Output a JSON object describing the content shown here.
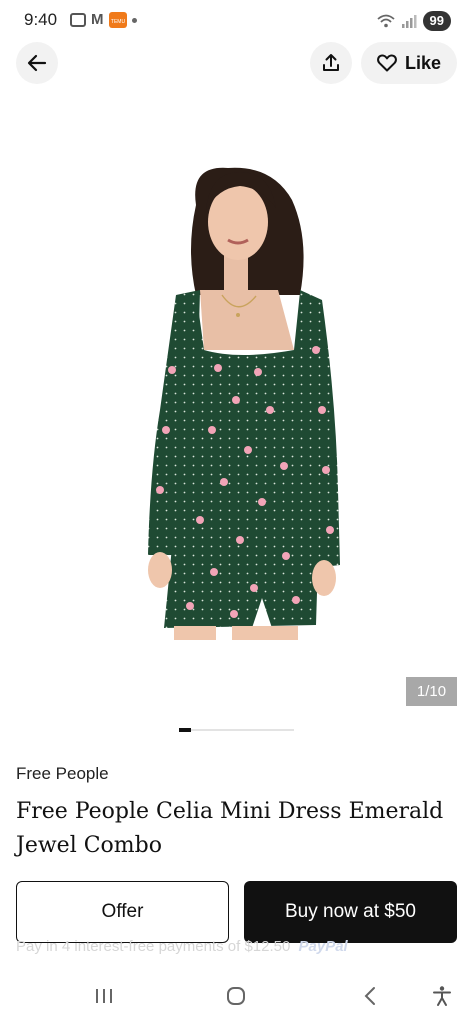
{
  "status_bar": {
    "time": "9:40",
    "app_icon_text": "TEMU",
    "battery": "99",
    "icons": [
      "screenshot-icon",
      "gmail-icon",
      "app-notification-icon",
      "dot-icon",
      "wifi-icon",
      "signal-icon",
      "battery-icon"
    ]
  },
  "top_bar": {
    "like_label": "Like"
  },
  "gallery": {
    "counter": "1/10",
    "current": 1,
    "total": 10
  },
  "product": {
    "brand": "Free People",
    "title": "Free People Celia Mini Dress Emerald Jewel Combo"
  },
  "actions": {
    "offer_label": "Offer",
    "buy_label": "Buy now at $50"
  },
  "payment": {
    "installment_text": "Pay in 4 interest-free payments of $12.50",
    "provider": "PayPal"
  },
  "colors": {
    "accent": "#111111",
    "dress": "#1f4a33",
    "counter_bg": "#a8a8a8"
  }
}
